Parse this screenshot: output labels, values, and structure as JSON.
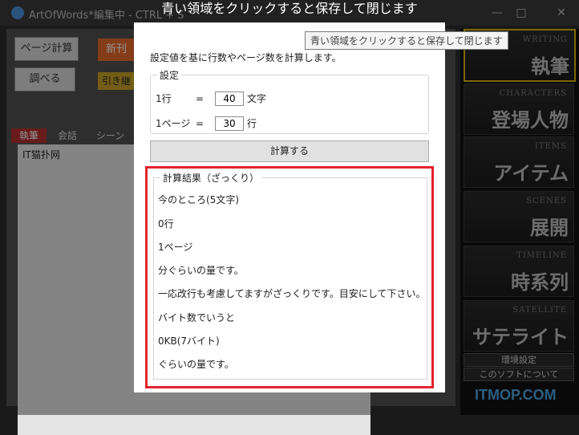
{
  "window": {
    "title": "ArtOfWords*編集中 - CTRL + S",
    "controls": [
      "—",
      "□",
      "✕"
    ]
  },
  "left_panel": {
    "page_calc_button": "ページ計算",
    "search_button": "調べる",
    "orange_button": "新刊",
    "yellow_button": "引き継",
    "tabs": [
      "執筆",
      "会話",
      "シーン"
    ],
    "text_content": "IT猫扑网"
  },
  "right_menu": {
    "items": [
      {
        "en": "WRITING",
        "jp": "執筆"
      },
      {
        "en": "CHARACTERS",
        "jp": "登場人物"
      },
      {
        "en": "ITEMS",
        "jp": "アイテム"
      },
      {
        "en": "SCENES",
        "jp": "展開"
      },
      {
        "en": "TIMELINE",
        "jp": "時系列"
      },
      {
        "en": "SATELLITE",
        "jp": "サテライト"
      }
    ],
    "settings_button": "環境設定",
    "about_button": "このソフトについて"
  },
  "overlay": {
    "title": "青い領域をクリックすると保存して閉じます"
  },
  "dialog": {
    "tooltip": "青い領域をクリックすると保存して閉じます",
    "description": "設定値を基に行数やページ数を計算します。",
    "settings_legend": "設定",
    "row1": {
      "label": "1行",
      "eq": "=",
      "value": "40",
      "unit": "文字"
    },
    "row2": {
      "label": "1ページ",
      "eq": "=",
      "value": "30",
      "unit": "行"
    },
    "calc_button": "計算する",
    "results_legend": "計算結果（ざっくり）",
    "results": [
      "今のところ(5文字)",
      "0行",
      "1ページ",
      "分ぐらいの量です。",
      "一応改行も考慮してますがざっくりです。目安にして下さい。",
      "バイト数でいうと",
      "0KB(7バイト)",
      "ぐらいの量です。"
    ]
  },
  "watermark": "ITMOP.COM",
  "colors": {
    "highlight_border": "#e0252d",
    "active_tab": "#b13030",
    "orange_button": "#e46a2a",
    "yellow_button": "#c9a227"
  }
}
